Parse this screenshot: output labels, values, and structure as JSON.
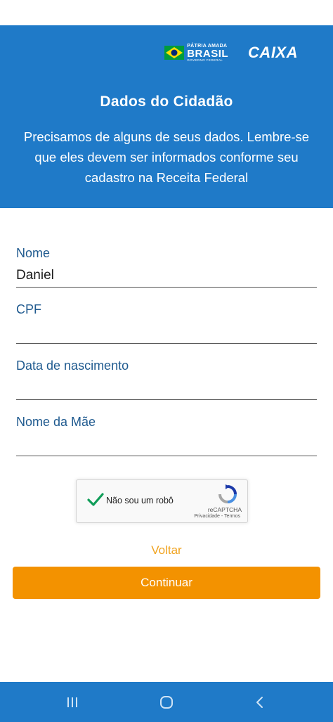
{
  "header": {
    "gov_logo": {
      "line1": "PÁTRIA AMADA",
      "line2": "BRASIL",
      "line3": "GOVERNO FEDERAL"
    },
    "brand_logo": "CAIXA",
    "title": "Dados do Cidadão",
    "subtitle": "Precisamos de alguns de seus dados. Lembre-se que eles devem ser informados conforme seu cadastro na Receita Federal"
  },
  "form": {
    "fields": [
      {
        "label": "Nome",
        "value": "Daniel"
      },
      {
        "label": "CPF",
        "value": ""
      },
      {
        "label": "Data de nascimento",
        "value": ""
      },
      {
        "label": "Nome da Mãe",
        "value": ""
      }
    ]
  },
  "captcha": {
    "label": "Não sou um robô",
    "checked": true,
    "brand": "reCAPTCHA",
    "links": "Privacidade - Termos"
  },
  "actions": {
    "back_label": "Voltar",
    "continue_label": "Continuar"
  },
  "nav": {
    "icons": [
      "recent-apps-icon",
      "home-icon",
      "back-icon"
    ]
  },
  "colors": {
    "header_blue": "#1f7ac8",
    "field_label": "#1f5a8f",
    "accent_orange": "#f39200",
    "link_orange": "#f0a31f"
  }
}
